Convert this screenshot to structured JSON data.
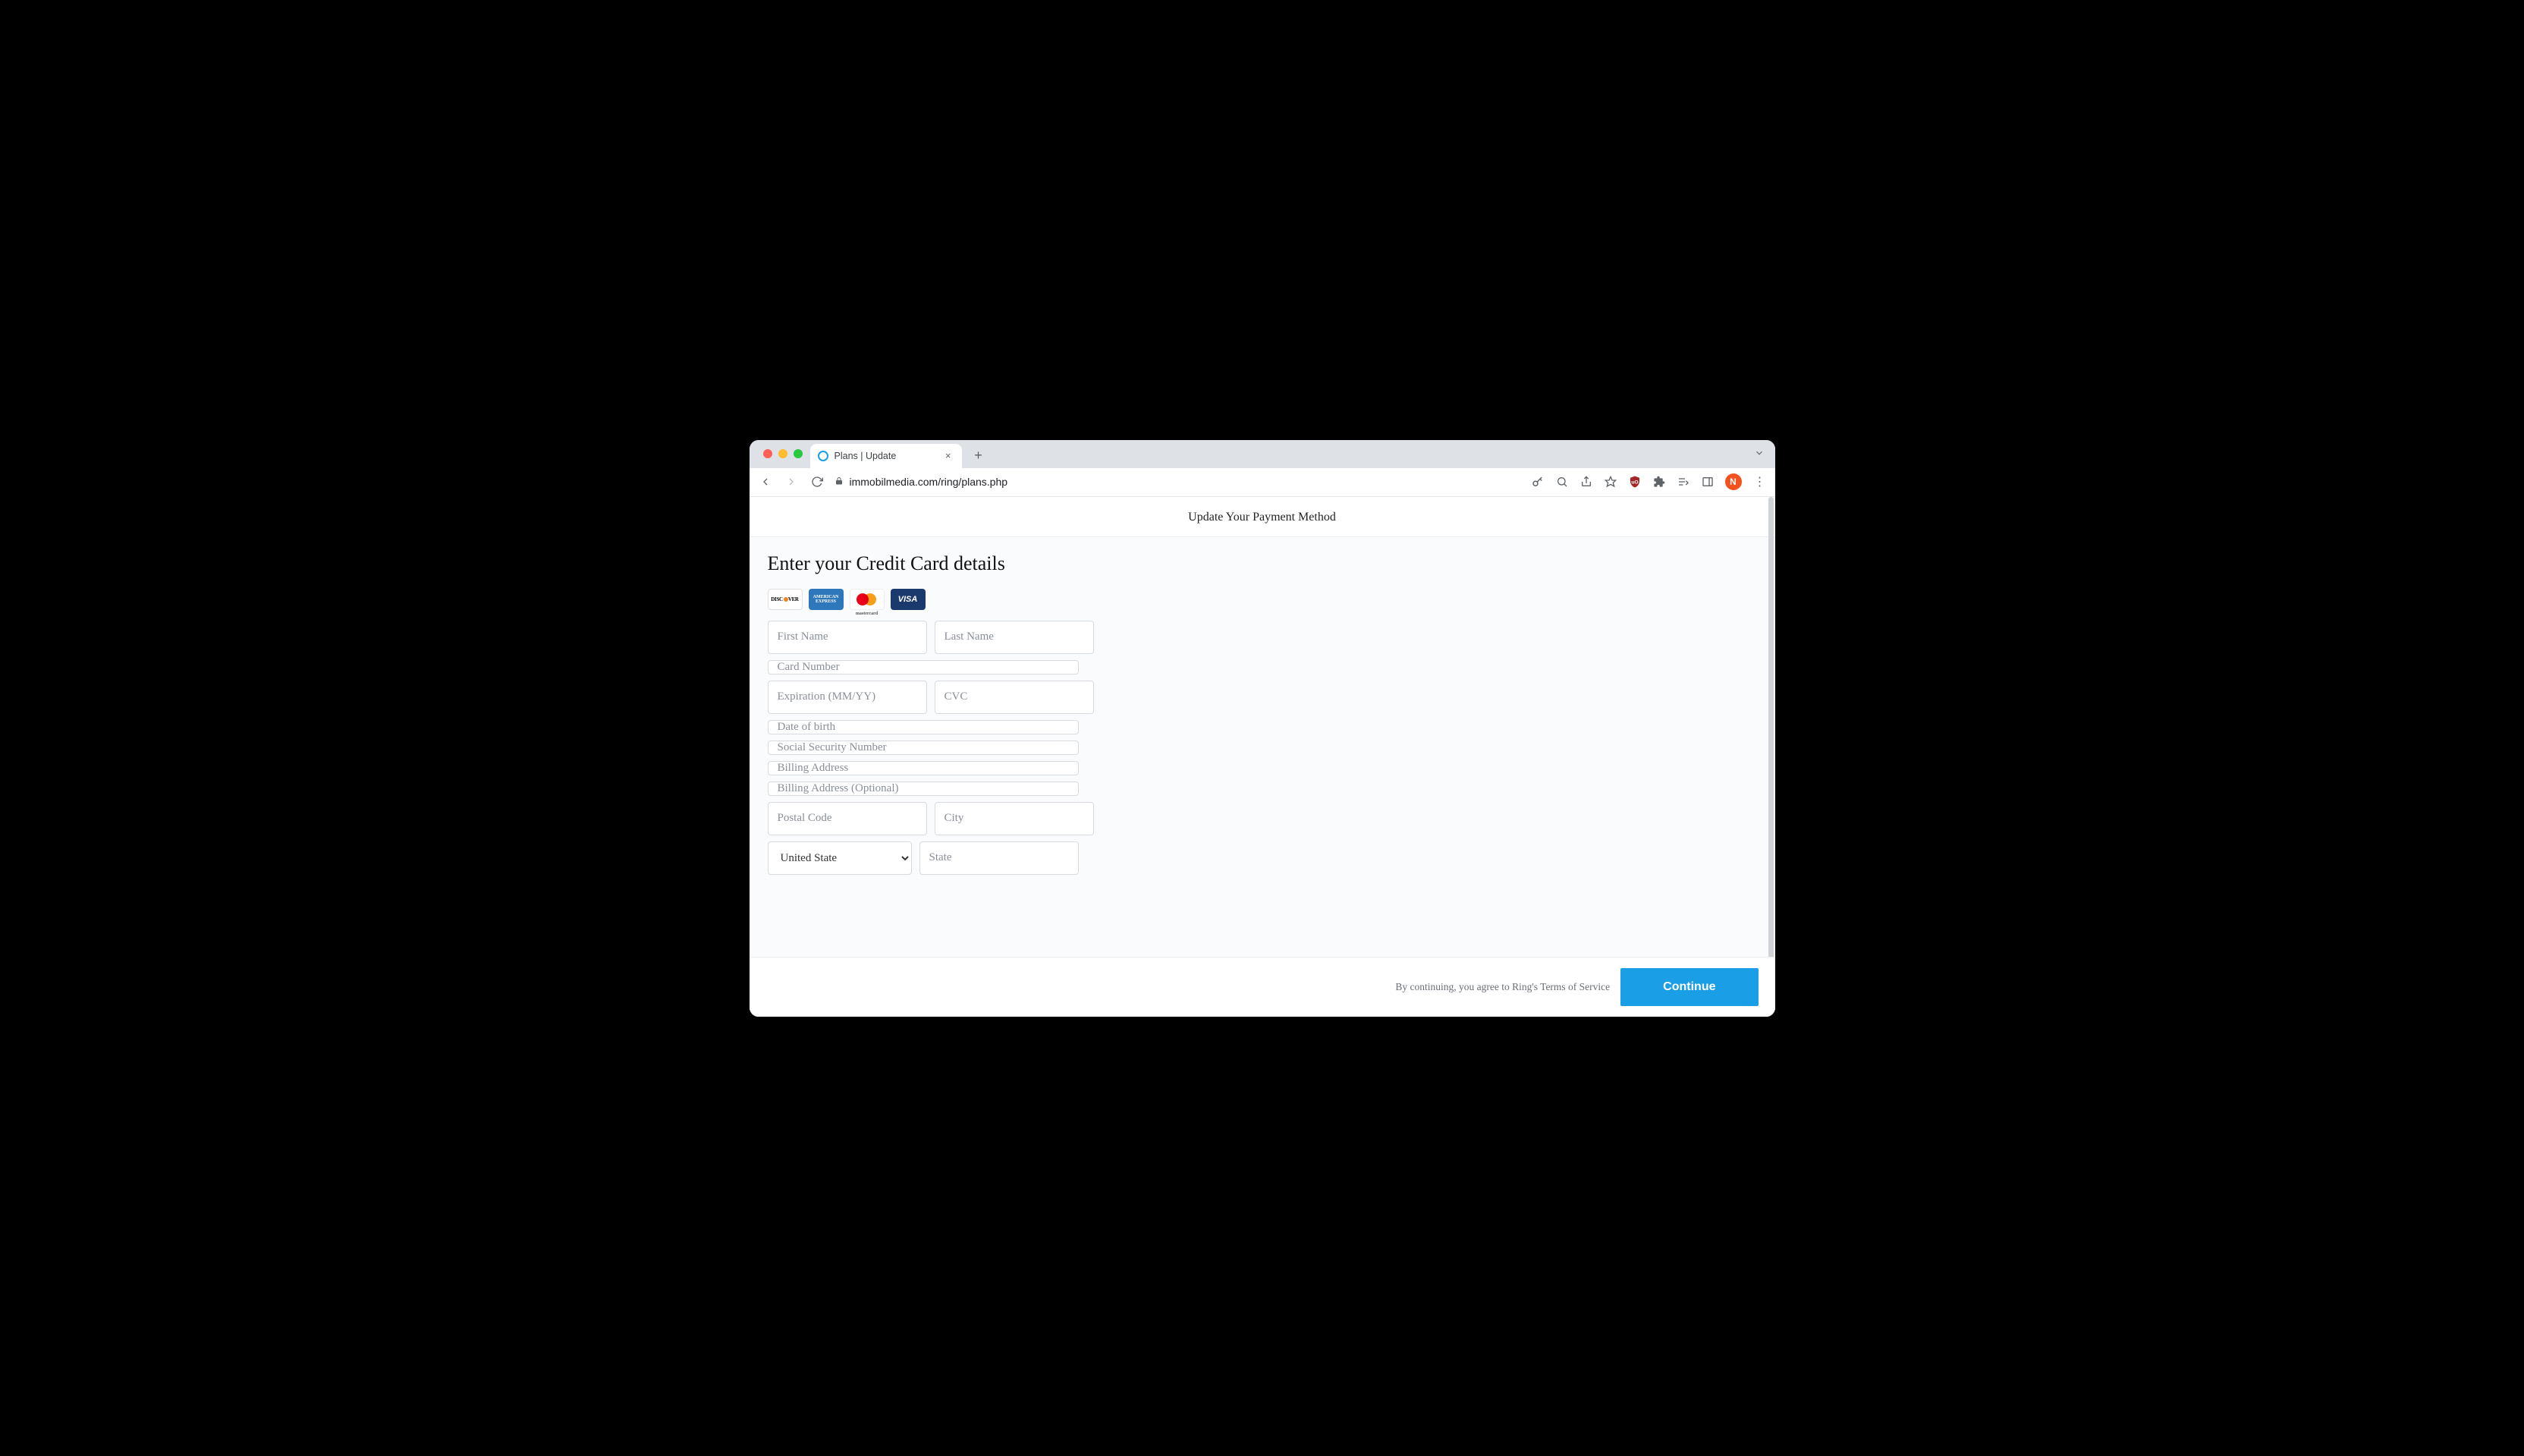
{
  "browser": {
    "tab_title": "Plans | Update",
    "url": "immobilmedia.com/ring/plans.php",
    "avatar_initial": "N"
  },
  "page": {
    "header": "Update Your Payment Method",
    "form_title": "Enter your Credit Card details",
    "cards": {
      "discover": "DISCOVER",
      "amex": "AMERICAN EXPRESS",
      "mastercard": "mastercard",
      "visa": "VISA"
    },
    "placeholders": {
      "first_name": "First Name",
      "last_name": "Last Name",
      "card_number": "Card Number",
      "expiration": "Expiration (MM/YY)",
      "cvc": "CVC",
      "dob": "Date of birth",
      "ssn": "Social Security Number",
      "billing1": "Billing Address",
      "billing2": "Billing Address (Optional)",
      "postal": "Postal Code",
      "city": "City",
      "state": "State"
    },
    "country_selected": "United State",
    "footer_terms": "By continuing, you agree to Ring's Terms of Service",
    "continue_label": "Continue"
  }
}
